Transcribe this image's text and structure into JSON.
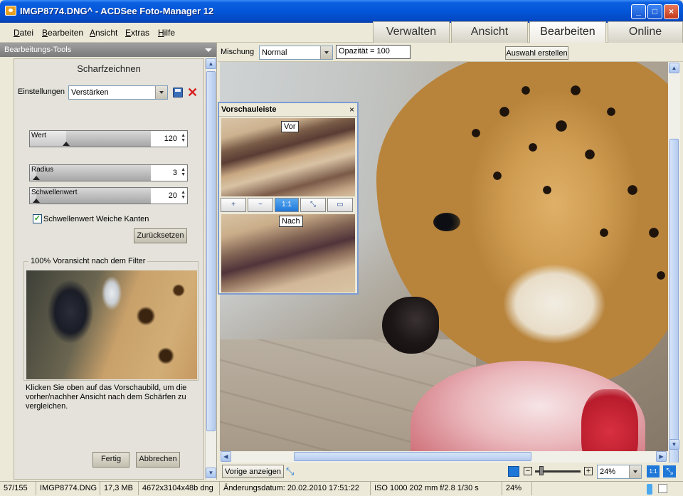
{
  "window": {
    "title": "IMGP8774.DNG^ - ACDSee Foto-Manager 12",
    "min_label": "_",
    "max_label": "□",
    "close_label": "×"
  },
  "menu": {
    "items": [
      {
        "u": "D",
        "rest": "atei"
      },
      {
        "u": "B",
        "rest": "earbeiten"
      },
      {
        "u": "A",
        "rest": "nsicht"
      },
      {
        "u": "E",
        "rest": "xtras"
      },
      {
        "u": "H",
        "rest": "ilfe"
      }
    ]
  },
  "modes": {
    "tabs": [
      "Verwalten",
      "Ansicht",
      "Bearbeiten",
      "Online"
    ],
    "active": "Bearbeiten"
  },
  "panel": {
    "header": "Bearbeitungs-Tools",
    "tool_title": "Scharfzeichnen",
    "settings_label": "Einstellungen",
    "settings_value": "Verstärken",
    "sliders": [
      {
        "label": "Wert",
        "value": "120",
        "fraction": 0.3
      },
      {
        "label": "Radius",
        "value": "3",
        "fraction": 0.05
      },
      {
        "label": "Schwellenwert",
        "value": "20",
        "fraction": 0.05
      }
    ],
    "checkbox_label": "Schwellenwert Weiche Kanten",
    "checkbox_checked": true,
    "reset_button": "Zurücksetzen",
    "preview_group": "100% Voransicht nach dem Filter",
    "hint": "Klicken Sie oben auf das Vorschaubild, um die vorher/nachher Ansicht nach dem Schärfen zu vergleichen.",
    "done_button": "Fertig",
    "cancel_button": "Abbrechen"
  },
  "toolbar": {
    "blend_label": "Mischung",
    "blend_value": "Normal",
    "opacity_text": "Opazität = 100",
    "selection_button": "Auswahl erstellen"
  },
  "preview_window": {
    "title": "Vorschauleiste",
    "close": "×",
    "before": "Vor",
    "after": "Nach",
    "tool_labels": [
      "+",
      "−",
      "1:1",
      "⤡",
      "▭"
    ]
  },
  "viewbar": {
    "prev_button": "Vorige anzeigen",
    "zoom_value": "24%",
    "one_to_one": "1:1"
  },
  "status": {
    "items": [
      "57/155",
      "IMGP8774.DNG",
      "17,3 MB",
      "4672x3104x48b dng",
      "Änderungsdatum: 20.02.2010 17:51:22",
      "ISO 1000  202 mm  f/2.8  1/30 s",
      "24%"
    ]
  },
  "colors": {
    "title_blue": "#0356d8",
    "close_red": "#c2381b",
    "delete_red": "#d82020",
    "check_green": "#21a121"
  }
}
